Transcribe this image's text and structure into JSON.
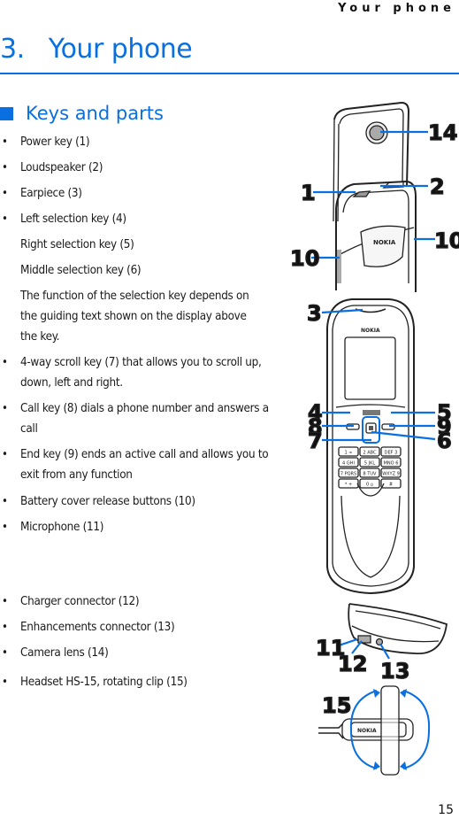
{
  "running_header": "Your phone",
  "chapter": {
    "number": "3.",
    "title": "Your phone",
    "full": "3.   Your phone"
  },
  "section": {
    "title": "Keys and parts"
  },
  "items": [
    {
      "bullet": true,
      "text": "Power key (1)"
    },
    {
      "bullet": true,
      "text": "Loudspeaker (2)"
    },
    {
      "bullet": true,
      "text": "Earpiece (3)"
    },
    {
      "bullet": true,
      "text": "Left selection key (4)"
    },
    {
      "bullet": false,
      "text": "Right selection key (5)"
    },
    {
      "bullet": false,
      "text": "Middle selection key (6)"
    },
    {
      "bullet": false,
      "text": "The function of the selection key depends on the guiding text shown on the display above the key."
    },
    {
      "bullet": true,
      "text": "4-way scroll key (7) that allows you to scroll up, down, left and right."
    },
    {
      "bullet": true,
      "text": "Call key (8) dials a phone number and answers a call"
    },
    {
      "bullet": true,
      "text": "End key (9) ends an active call and allows you to exit from any function"
    },
    {
      "bullet": true,
      "text": "Battery cover release buttons (10)"
    },
    {
      "bullet": true,
      "text": "Microphone (11)"
    },
    {
      "bullet": true,
      "text": "Charger connector (12)"
    },
    {
      "bullet": true,
      "text": "Enhancements connector (13)"
    },
    {
      "bullet": true,
      "text": "Camera lens (14)"
    },
    {
      "bullet": true,
      "text": "Headset HS-15, rotating clip (15)"
    }
  ],
  "bullet_glyph": "•",
  "illustration": {
    "brand": "NOKIA",
    "callouts": [
      "14",
      "1",
      "2",
      "10",
      "10",
      "3",
      "4",
      "5",
      "8",
      "9",
      "7",
      "6",
      "11",
      "12",
      "13",
      "15"
    ],
    "keypad": [
      [
        "1 ∞",
        "2 ABC",
        "DEF 3"
      ],
      [
        "4 GHI",
        "5 JKL",
        "MNO 6"
      ],
      [
        "7 PQRS",
        "8 TUV",
        "WXYZ 9"
      ],
      [
        "* +",
        "0 ⌂",
        "# "
      ]
    ],
    "accent_color": "#0a6fe0"
  },
  "page_number": "15",
  "colors": {
    "accent": "#0a6fe0",
    "text": "#1a1a1a"
  }
}
